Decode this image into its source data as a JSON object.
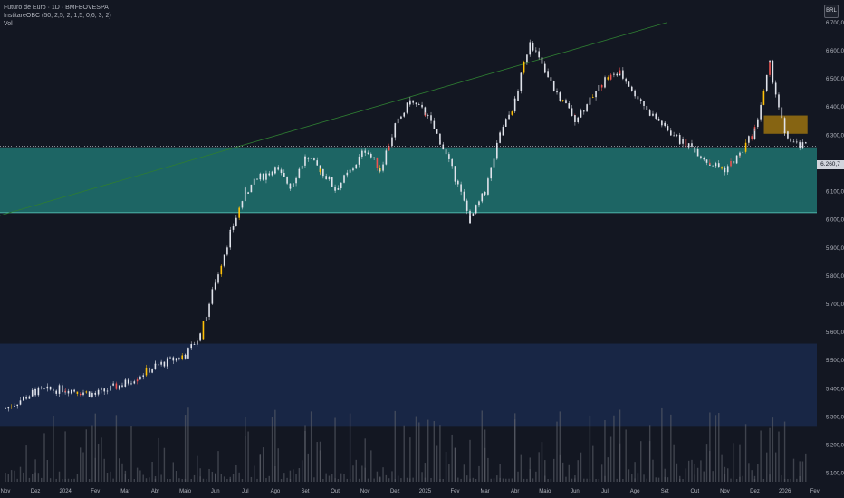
{
  "legend": {
    "symbol_line": "Futuro de Euro · 1D · BMFBOVESPA",
    "indicator_line": "InstitareOBC (50, 2,5, 2, 1,5, 0,6, 3, 2)",
    "volume_line": "Vol"
  },
  "currency_button": "BRL",
  "last_price_label": "6.260,7",
  "colors": {
    "background": "#131722",
    "zone_teal": "#26a69a",
    "zone_blue": "#1e3a70",
    "zone_orange": "#b8860b",
    "trendline": "#2e7d32",
    "candle_up": "#e0e3eb",
    "candle_down": "#ef5350",
    "candle_signal": "#ffc107",
    "volume": "#5d606b"
  },
  "chart_data": {
    "type": "candlestick",
    "title": "Futuro de Euro · 1D · BMFBOVESPA",
    "y_ticks": [
      "6.700,0",
      "6.600,0",
      "6.500,0",
      "6.400,0",
      "6.300,0",
      "6.200,0",
      "6.100,0",
      "6.000,0",
      "5.900,0",
      "5.800,0",
      "5.700,0",
      "5.600,0",
      "5.500,0",
      "5.400,0",
      "5.300,0",
      "5.200,0",
      "5.100,0"
    ],
    "x_ticks": [
      "Nov",
      "Dez",
      "2024",
      "Fev",
      "Mar",
      "Abr",
      "Maio",
      "Jun",
      "Jul",
      "Ago",
      "Set",
      "Out",
      "Nov",
      "Dez",
      "2025",
      "Fev",
      "Mar",
      "Abr",
      "Maio",
      "Jun",
      "Jul",
      "Ago",
      "Set",
      "Out",
      "Nov",
      "Dez",
      "2026",
      "Fev"
    ],
    "ylim": [
      5070,
      6780
    ],
    "last_price": 6260.7,
    "zones": [
      {
        "name": "teal",
        "low": 6025,
        "high": 6255
      },
      {
        "name": "blue",
        "low": 5265,
        "high": 5560
      },
      {
        "name": "orange",
        "low": 6305,
        "high": 6370,
        "from": "Dez 2025",
        "to": "Fev 2026"
      }
    ],
    "trendline": [
      {
        "x": "Nov 2023",
        "y": 6015
      },
      {
        "x": "Set 2025",
        "y": 6700
      }
    ],
    "price_path": [
      [
        "Nov 2023",
        5330
      ],
      [
        "Dez 2023",
        5390
      ],
      [
        "2024",
        5400
      ],
      [
        "Fev 2024",
        5380
      ],
      [
        "Mar 2024",
        5420
      ],
      [
        "Abr 2024",
        5480
      ],
      [
        "Maio 2024",
        5520
      ],
      [
        "Maio 2024",
        5590
      ],
      [
        "Jun 2024",
        5780
      ],
      [
        "Jun 2024",
        5950
      ],
      [
        "Jul 2024",
        6100
      ],
      [
        "Jul 2024",
        6150
      ],
      [
        "Ago 2024",
        6180
      ],
      [
        "Ago 2024",
        6120
      ],
      [
        "Set 2024",
        6220
      ],
      [
        "Set 2024",
        6180
      ],
      [
        "Out 2024",
        6110
      ],
      [
        "Out 2024",
        6170
      ],
      [
        "Nov 2024",
        6250
      ],
      [
        "Nov 2024",
        6180
      ],
      [
        "Dez 2024",
        6330
      ],
      [
        "Dez 2024",
        6420
      ],
      [
        "2025",
        6380
      ],
      [
        "2025",
        6280
      ],
      [
        "Fev 2025",
        6150
      ],
      [
        "Fev 2025",
        6000
      ],
      [
        "Mar 2025",
        6100
      ],
      [
        "Mar 2025",
        6300
      ],
      [
        "Abr 2025",
        6420
      ],
      [
        "Abr 2025",
        6640
      ],
      [
        "Maio 2025",
        6520
      ],
      [
        "Maio 2025",
        6430
      ],
      [
        "Jun 2025",
        6360
      ],
      [
        "Jun 2025",
        6420
      ],
      [
        "Jul 2025",
        6500
      ],
      [
        "Jul 2025",
        6520
      ],
      [
        "Ago 2025",
        6450
      ],
      [
        "Ago 2025",
        6380
      ],
      [
        "Set 2025",
        6330
      ],
      [
        "Set 2025",
        6280
      ],
      [
        "Out 2025",
        6250
      ],
      [
        "Out 2025",
        6200
      ],
      [
        "Nov 2025",
        6180
      ],
      [
        "Nov 2025",
        6230
      ],
      [
        "Dez 2025",
        6320
      ],
      [
        "Dez 2025",
        6550
      ],
      [
        "2026",
        6300
      ],
      [
        "2026",
        6260
      ],
      [
        "Fev 2026",
        6261
      ]
    ]
  }
}
